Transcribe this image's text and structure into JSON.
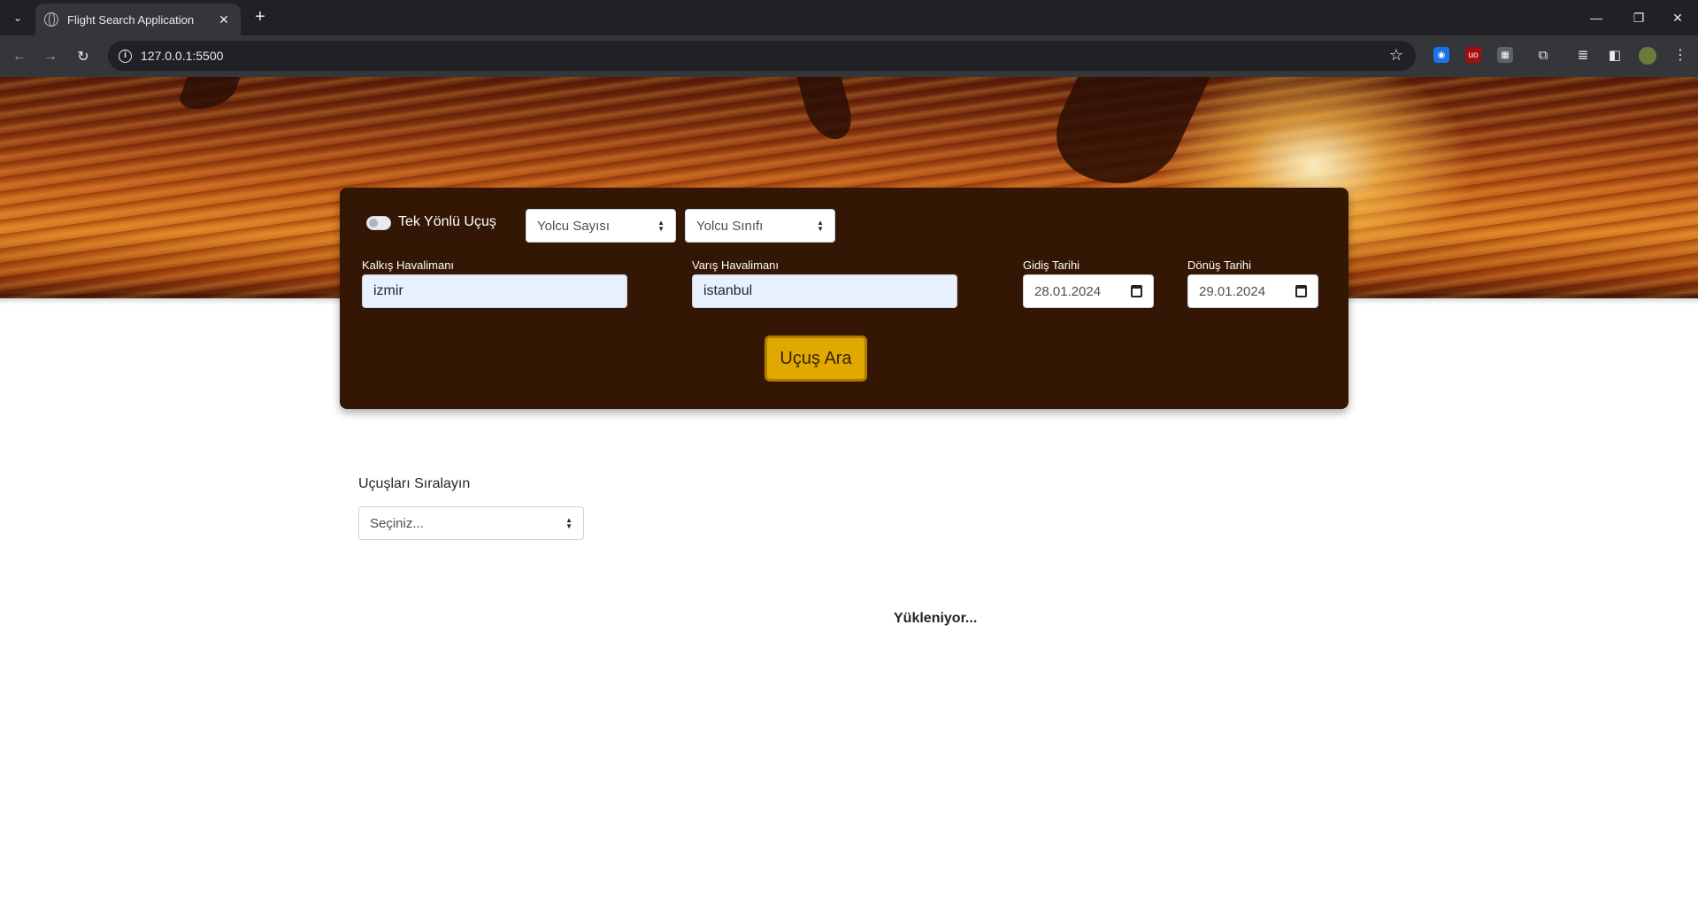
{
  "browser": {
    "tab_title": "Flight Search Application",
    "url": "127.0.0.1:5500",
    "extensions": [
      {
        "name": "ext-blue",
        "color": "#1a73e8",
        "glyph": "◉"
      },
      {
        "name": "ext-ublock",
        "color": "#a50e0e",
        "glyph": "uo"
      },
      {
        "name": "ext-grid",
        "color": "#5f6368",
        "glyph": "▦"
      }
    ]
  },
  "search_form": {
    "one_way_label": "Tek Yönlü Uçuş",
    "passenger_count_select": "Yolcu Sayısı",
    "passenger_class_select": "Yolcu Sınıfı",
    "departure_airport_label": "Kalkış Havalimanı",
    "departure_airport_value": "izmir",
    "arrival_airport_label": "Varış Havalimanı",
    "arrival_airport_value": "istanbul",
    "departure_date_label": "Gidiş Tarihi",
    "departure_date_value": "28.01.2024",
    "return_date_label": "Dönüş Tarihi",
    "return_date_value": "29.01.2024",
    "search_button": "Uçuş Ara"
  },
  "results": {
    "sort_label": "Uçuşları Sıralayın",
    "sort_select": "Seçiniz...",
    "loading_text": "Yükleniyor..."
  },
  "colors": {
    "panel_bg": "#331604",
    "button_bg": "#e0a800"
  }
}
